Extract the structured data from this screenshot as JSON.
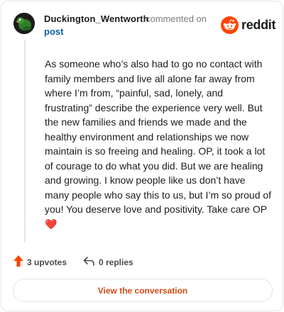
{
  "comment": {
    "author": "Duckington_Wentworth",
    "action_text": "commented on",
    "target_link": "post",
    "body": "As someone who’s also had to go no contact with family members and live all alone far away from where I’m from, “painful, sad, lonely, and frustrating” describe the experience very well. But the new families and friends we made and the healthy environment and relationships we now maintain is so freeing and healing. OP, it took a lot of courage to do what you did. But we are healing and growing. I know people like us don’t have many people who say this to us, but I’m so proud of you! You deserve love and positivity. Take care OP",
    "body_emoji": "❤️"
  },
  "brand": {
    "name": "reddit",
    "logo_icon": "reddit-snoo-icon",
    "accent_color": "#ff4500"
  },
  "footer": {
    "upvotes_label": "3 upvotes",
    "upvote_icon": "upvote-arrow-icon",
    "upvote_color": "#ff4500",
    "replies_label": "0 replies",
    "reply_icon": "reply-arrow-icon",
    "view_button_label": "View the conversation",
    "view_button_color": "#d04a12"
  }
}
